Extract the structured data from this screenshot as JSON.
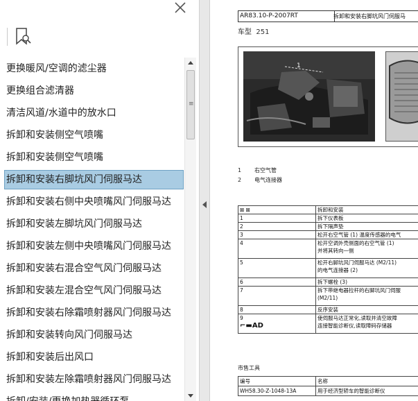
{
  "sidebar": {
    "close_icon": "close-icon",
    "bookmark_icon": "bookmark-search-icon",
    "items": [
      {
        "label": "更换暖风/空调的滤尘器"
      },
      {
        "label": "更换组合滤清器"
      },
      {
        "label": "清洁风道/水道中的放水口"
      },
      {
        "label": "拆卸和安装侧空气喷嘴"
      },
      {
        "label": "拆卸和安装侧空气喷嘴"
      },
      {
        "label": "拆卸和安装右脚坑风门伺服马达",
        "selected": true
      },
      {
        "label": "拆卸和安装右侧中央喷嘴风门伺服马达"
      },
      {
        "label": "拆卸和安装左脚坑风门伺服马达"
      },
      {
        "label": "拆卸和安装左侧中央喷嘴风门伺服马达"
      },
      {
        "label": "拆卸和安装右混合空气风门伺服马达"
      },
      {
        "label": "拆卸和安装左混合空气风门伺服马达"
      },
      {
        "label": "拆卸和安装右除霜喷射器风门伺服马达"
      },
      {
        "label": "拆卸和安装转向风门伺服马达"
      },
      {
        "label": "拆卸和安装后出风口"
      },
      {
        "label": "拆卸和安装左除霜喷射器风门伺服马达"
      },
      {
        "label": "拆卸/安装/更换加热器循环泵"
      }
    ],
    "selected_color": "#a9cce3"
  },
  "document": {
    "doc_id": "AR83.10-P-2007RT",
    "doc_title": "拆卸和安装右脚坑风门伺服马",
    "model_label": "车型",
    "model_value": "251",
    "figure_callout": "1",
    "legend": [
      {
        "num": "1",
        "text": "右空气管"
      },
      {
        "num": "2",
        "text": "电气连接器"
      }
    ],
    "steps": [
      {
        "col1": "⊠ ⊠",
        "col2": "拆卸和安装"
      },
      {
        "col1": "1",
        "col2": "拆下仪表板"
      },
      {
        "col1": "2",
        "col2": "拆下隔声垫"
      },
      {
        "col1": "3",
        "col2": "松开右空气管 (1) 温度传感器的电气"
      },
      {
        "col1": "4",
        "col2": "松开空调外壳侧面的右空气管 (1)",
        "col2b": "并将其转向一侧"
      },
      {
        "col1": "5",
        "col2": "松开右脚坑风门伺服马达 (M2/11)",
        "col2b": "的电气连接器 (2)"
      },
      {
        "col1": "6",
        "col2": "拆下螺栓 (3)"
      },
      {
        "col1": "7",
        "col2": "拆下带继电器拉杆的右脚坑风门伺服",
        "col2b": "(M2/11)"
      },
      {
        "col1": "8",
        "col2": "反序安装"
      },
      {
        "col1": "9",
        "col1b": "AD",
        "col2": "使伺服马达正常化,读取并清空故障",
        "col2b": "连接智能诊断仪,读取障码存储器"
      }
    ],
    "tools_label": "市售工具",
    "tools_header": {
      "col1": "编号",
      "col2": "名称"
    },
    "tools_rows": [
      {
        "col1": "WH58.30-Z-1048-13A",
        "col2": "用于经济型轿车的智能诊断仪"
      }
    ]
  }
}
